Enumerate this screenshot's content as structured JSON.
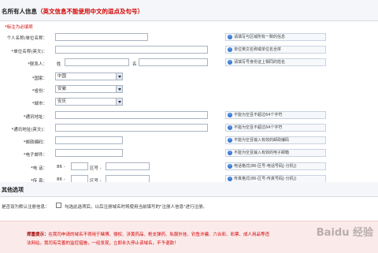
{
  "header": {
    "title": "名所有人信息",
    "note": "（英文信息不能使用中文的逗点及句号）"
  },
  "required_note": "*标注为必填项",
  "fields": {
    "org_name_cn": {
      "label": "个人名称/单位名称：",
      "hint": "请填写与区域所有一致的信息"
    },
    "org_name_en": {
      "label": "*单位名称(英文)：",
      "hint": "单位英文名称或单位名全拼"
    },
    "contact": {
      "label": "*联系人：",
      "surname_label": "姓",
      "given_label": "名",
      "hint": "请填写号身份证上相同的姓名"
    },
    "country": {
      "label": "*国家：",
      "value": "中国"
    },
    "province": {
      "label": "*省份：",
      "value": "安徽"
    },
    "city": {
      "label": "*城市：",
      "value": "安庆"
    },
    "address_cn": {
      "label": "*通讯地址：",
      "hint": "不能为空且不超过64个字符"
    },
    "address_en": {
      "label": "*通讯地址(英文)：",
      "hint": "不能为空且不超过64个字符"
    },
    "postcode": {
      "label": "*邮政编码：",
      "hint": "不能为空且输入有效的邮政编码"
    },
    "email": {
      "label": "*电子邮件：",
      "hint": "不能为空且输入有效的电子邮箱"
    },
    "phone": {
      "label": "*电  话：",
      "country_code": "86",
      "sep": "-",
      "area_label": "区号",
      "hint": "电话格式(86-区号-电话号码[-分机])"
    },
    "fax": {
      "label": "*传  真：",
      "country_code": "86",
      "sep": "-",
      "area_label": "区号",
      "hint": "传真格式(86-区号-传真号码[-分机])"
    }
  },
  "section2": {
    "title": "其他选项",
    "default_label": "是否设为默认注册信息：",
    "checkbox_text": "勾选此选项后，以后注册域名时将使用当前填写的\"注册人信息\"进行注册。"
  },
  "warning": {
    "prefix": "郑重提示：",
    "line1": "在我司申请的域名不得用于赌博、侵权、涉黄药品、枪支弹药、私服外挂、钓鱼诈骗、六合彩、彩票、成人用品等违",
    "line2": "法网站，我司有完善的监控措施，一经发现，立即永久停止该域名，不予退款！"
  },
  "watermark": "Baidu 经验",
  "icons": {
    "hint": "info-icon",
    "select": "chevron-down-icon"
  }
}
